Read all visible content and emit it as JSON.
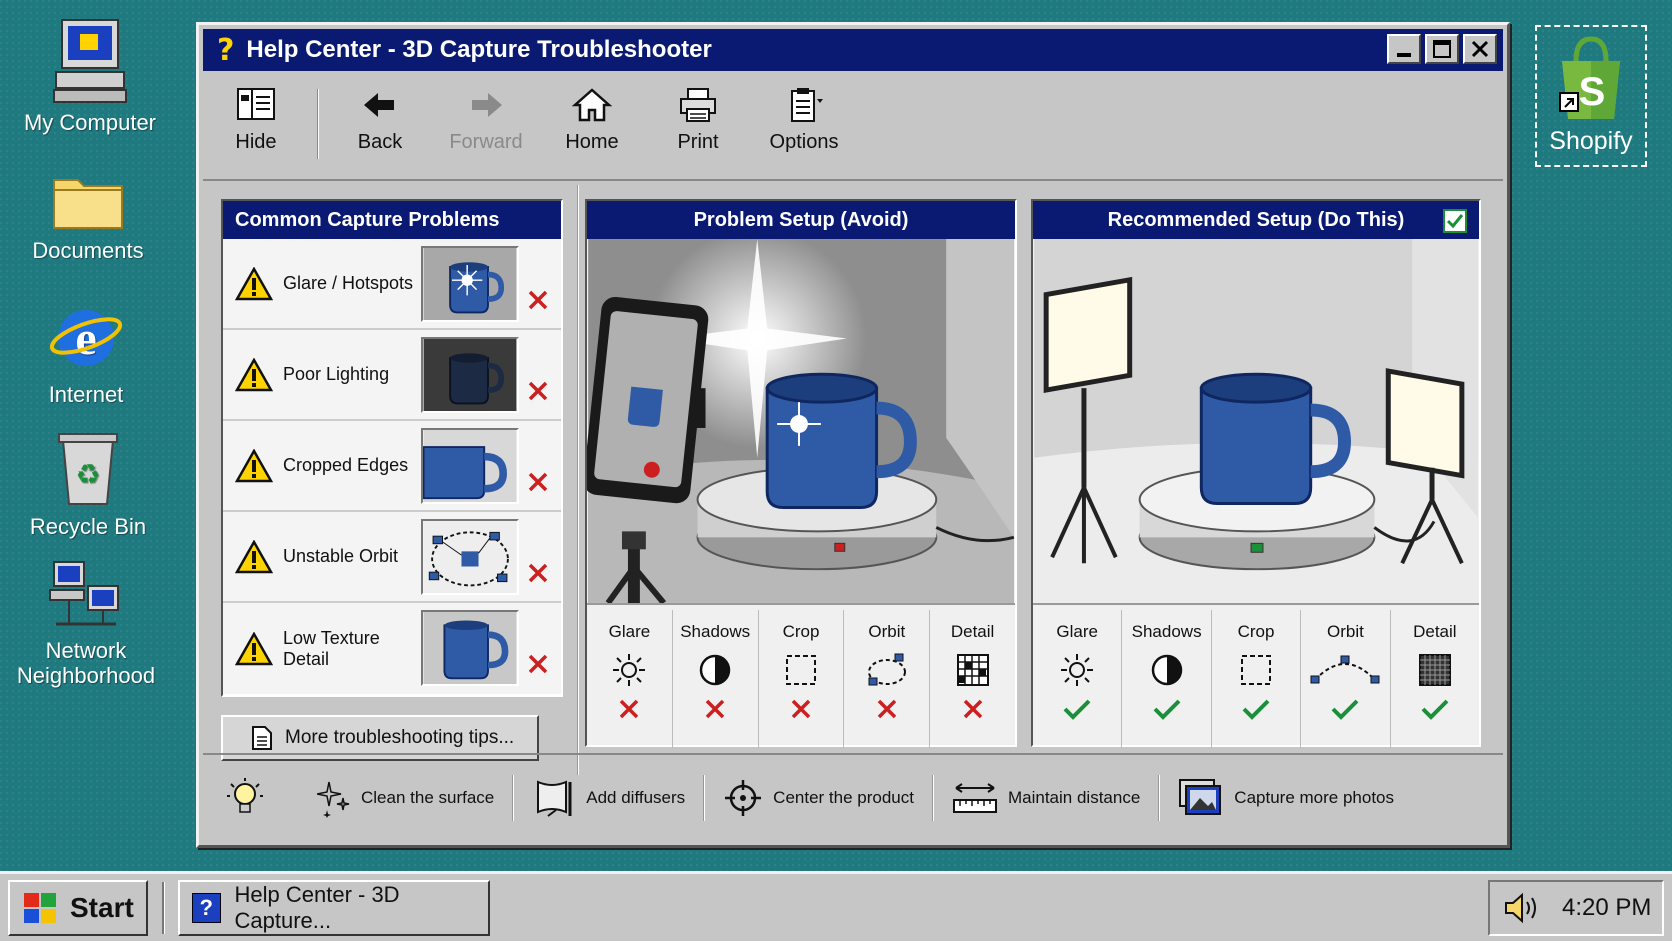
{
  "desktop": {
    "icons": [
      {
        "label": "My Computer",
        "icon": "computer-icon"
      },
      {
        "label": "Documents",
        "icon": "folder-icon"
      },
      {
        "label": "Internet",
        "icon": "internet-explorer-icon"
      },
      {
        "label": "Recycle Bin",
        "icon": "recycle-bin-icon"
      },
      {
        "label": "Network Neighborhood",
        "icon": "network-icon"
      }
    ],
    "shortcut": {
      "label": "Shopify",
      "icon": "shopify-bag-icon"
    }
  },
  "window": {
    "title": "Help Center - 3D Capture Troubleshooter",
    "toolbar": {
      "hide": "Hide",
      "back": "Back",
      "forward": "Forward",
      "home": "Home",
      "print": "Print",
      "options": "Options"
    },
    "problems": {
      "title": "Common Capture Problems",
      "items": [
        {
          "label": "Glare / Hotspots"
        },
        {
          "label": "Poor Lighting"
        },
        {
          "label": "Cropped Edges"
        },
        {
          "label": "Unstable Orbit"
        },
        {
          "label": "Low Texture Detail"
        }
      ],
      "more_button": "More troubleshooting tips..."
    },
    "problem_setup": {
      "title": "Problem Setup (Avoid)",
      "checks": [
        {
          "label": "Glare",
          "ok": false
        },
        {
          "label": "Shadows",
          "ok": false
        },
        {
          "label": "Crop",
          "ok": false
        },
        {
          "label": "Orbit",
          "ok": false
        },
        {
          "label": "Detail",
          "ok": false
        }
      ]
    },
    "recommended_setup": {
      "title": "Recommended Setup (Do This)",
      "checks": [
        {
          "label": "Glare",
          "ok": true
        },
        {
          "label": "Shadows",
          "ok": true
        },
        {
          "label": "Crop",
          "ok": true
        },
        {
          "label": "Orbit",
          "ok": true
        },
        {
          "label": "Detail",
          "ok": true
        }
      ]
    },
    "tips": [
      {
        "label": "Clean the surface"
      },
      {
        "label": "Add diffusers"
      },
      {
        "label": "Center the product"
      },
      {
        "label": "Maintain distance"
      },
      {
        "label": "Capture more photos"
      }
    ]
  },
  "taskbar": {
    "start": "Start",
    "task": "Help Center - 3D Capture...",
    "clock": "4:20 PM"
  },
  "colors": {
    "desktop": "#1f7a80",
    "titlebar": "#0a1a73",
    "mug": "#2f5aa6",
    "error": "#cc1f1f",
    "success": "#1b8f3a"
  }
}
